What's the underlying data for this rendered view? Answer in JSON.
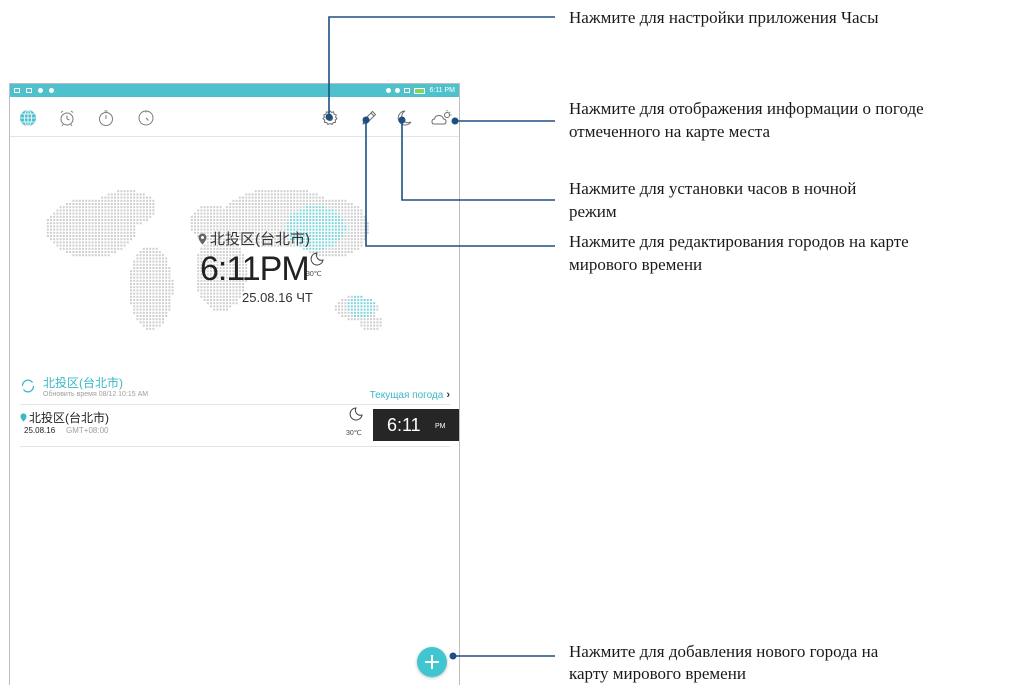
{
  "status_bar": {
    "time": "6:11 PM"
  },
  "toolbar": {
    "tabs": [
      {
        "name": "world-clock",
        "icon": "globe-icon"
      },
      {
        "name": "alarm",
        "icon": "alarm-clock-icon"
      },
      {
        "name": "stopwatch",
        "icon": "stopwatch-icon"
      },
      {
        "name": "timer",
        "icon": "timer-icon"
      }
    ],
    "actions": [
      {
        "name": "settings",
        "icon": "gear-icon"
      },
      {
        "name": "edit",
        "icon": "pencil-icon"
      },
      {
        "name": "night-mode",
        "icon": "moon-icon"
      },
      {
        "name": "weather",
        "icon": "cloud-sun-icon"
      }
    ]
  },
  "map_overlay": {
    "location": "北投区(台北市)",
    "time": "6:11PM",
    "temp": "30℃",
    "date": "25.08.16 ЧТ"
  },
  "weather_row": {
    "city": "北投区(台北市)",
    "updated": "Обновить время 08/12 10:15 AM",
    "link": "Текущая погода",
    "link_chevron": "›"
  },
  "city_list": [
    {
      "name": "北投区(台北市)",
      "date": "25.08.16",
      "gmt": "GMT+08:00",
      "temp": "30℃",
      "time": "6:11",
      "ampm": "PM"
    }
  ],
  "callouts": {
    "settings": "Нажмите для настройки приложения Часы",
    "weather_line1": "Нажмите для отображения информации о погоде",
    "weather_line2": "отмеченного на карте места",
    "night_line1": "Нажмите для установки часов в ночной",
    "night_line2": "режим",
    "edit_line1": "Нажмите для редактирования городов на карте",
    "edit_line2": "мирового времени",
    "add_line1": "Нажмите для добавления нового города на",
    "add_line2": "карту мирового времени"
  },
  "colors": {
    "accent": "#4fc1cc",
    "callout_line": "#1f4f82",
    "map_highlight": "#7fd6dc"
  }
}
